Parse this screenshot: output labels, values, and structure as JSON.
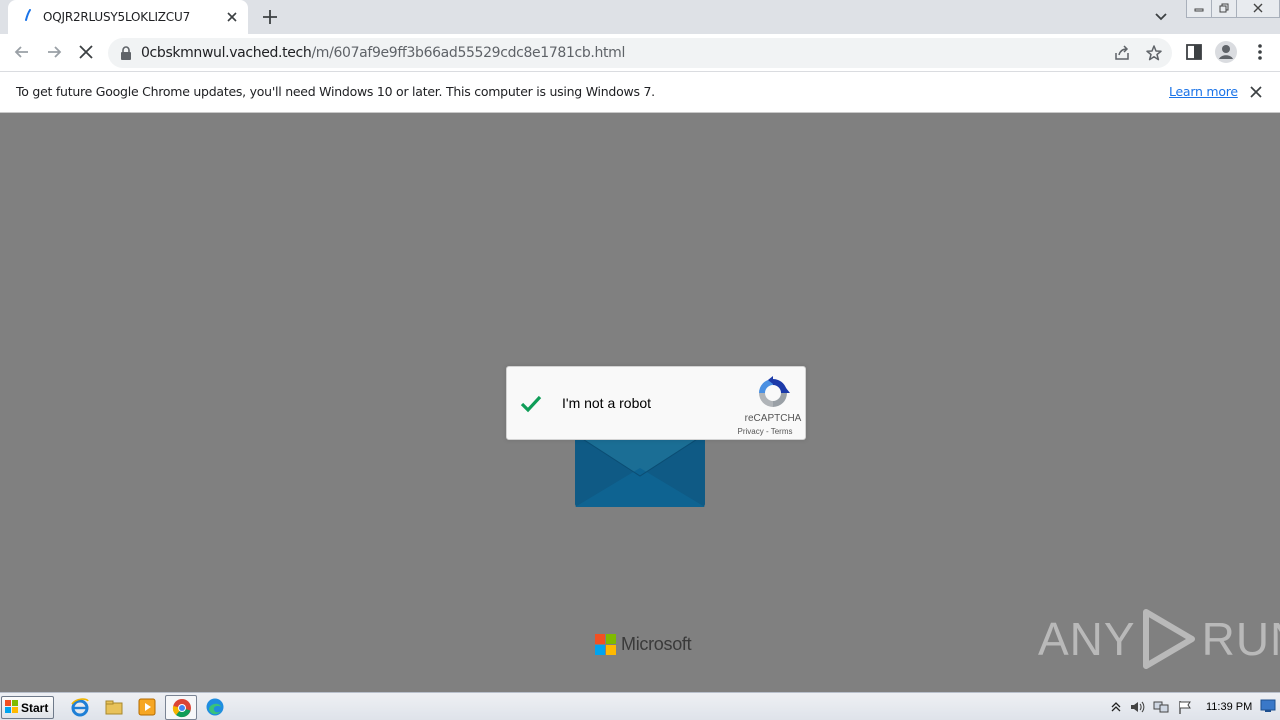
{
  "browser": {
    "tab": {
      "title": "OQJR2RLUSY5LOKLIZCU7",
      "spinner_icon": "loading-spinner-icon",
      "close_icon": "close-icon"
    },
    "new_tab_icon": "plus-icon",
    "tab_search_icon": "chevron-down-icon",
    "window_controls": [
      "minimize-icon",
      "restore-icon",
      "close-icon"
    ],
    "toolbar": {
      "back_icon": "arrow-left-icon",
      "forward_icon": "arrow-right-icon",
      "stop_icon": "stop-loading-icon",
      "lock_icon": "lock-icon",
      "url_host": "0cbskmnwul.vached.tech",
      "url_path": "/m/607af9e9ff3b66ad55529cdc8e1781cb.html",
      "share_icon": "share-icon",
      "bookmark_icon": "star-icon",
      "side_panel_icon": "side-panel-icon",
      "profile_icon": "profile-avatar-icon",
      "menu_icon": "kebab-menu-icon"
    },
    "infobar": {
      "message": "To get future Google Chrome updates, you'll need Windows 10 or later. This computer is using Windows 7.",
      "link_label": "Learn more",
      "close_icon": "close-icon"
    }
  },
  "page": {
    "captcha": {
      "label": "I'm not a robot",
      "checked": true,
      "brand": "reCAPTCHA",
      "privacy": "Privacy",
      "separator": "-",
      "terms": "Terms",
      "check_color": "#0f9d58"
    },
    "envelope_icon": "envelope-icon",
    "footer_brand": "Microsoft",
    "microsoft_colors": [
      "#f25022",
      "#7fba00",
      "#00a4ef",
      "#ffb900"
    ],
    "watermark_left": "ANY",
    "watermark_right": "RUN",
    "background_color": "#808080"
  },
  "taskbar": {
    "start_label": "Start",
    "pinned": [
      "internet-explorer-icon",
      "file-explorer-icon",
      "media-player-icon",
      "chrome-icon",
      "edge-icon"
    ],
    "active": "chrome-icon",
    "tray": [
      "show-hidden-icons-icon",
      "volume-icon",
      "network-icon",
      "action-center-flag-icon"
    ],
    "clock": "11:39 PM",
    "show_desktop_icon": "show-desktop-icon"
  }
}
